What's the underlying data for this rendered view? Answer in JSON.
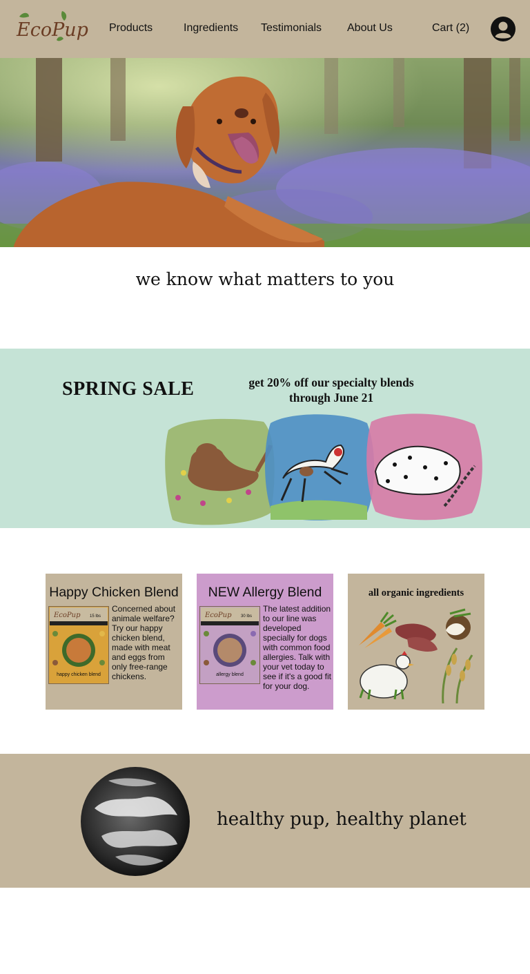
{
  "nav": {
    "logo_text": "EcoPup",
    "links": [
      "Products",
      "Ingredients",
      "Testimonials",
      "About Us",
      "Cart (2)"
    ]
  },
  "tagline": "we know what matters to you",
  "sale": {
    "title": "SPRING SALE",
    "line1": "get 20% off our specialty blends",
    "line2": "through June 21"
  },
  "cards": [
    {
      "title": "Happy Chicken Blend",
      "description": "Concerned about animale welfare? Try our happy chicken blend, made with meat and eggs from only free-range chickens.",
      "pack": {
        "brand": "EcoPup",
        "weight": "15 lbs",
        "label": "happy chicken blend",
        "color": "#d9a23a"
      }
    },
    {
      "title": "NEW  Allergy Blend",
      "description": "The latest addition to our line was developed specially for dogs with common food allergies. Talk with your vet today to see if it's a good fit for your dog.",
      "pack": {
        "brand": "EcoPup",
        "weight": "30 lbs",
        "label": "allergy blend",
        "color": "#c3a0c3"
      }
    },
    {
      "title": "all organic ingredients"
    }
  ],
  "planet_text": "healthy pup, healthy planet",
  "colors": {
    "nav_bg": "#c3b59c",
    "sale_bg": "#c5e3d6",
    "card1_bg": "#c3b59c",
    "card2_bg": "#cc9ccc",
    "card3_bg": "#c3b59c",
    "planet_bg": "#c3b59c"
  },
  "icons": [
    "account-icon"
  ]
}
